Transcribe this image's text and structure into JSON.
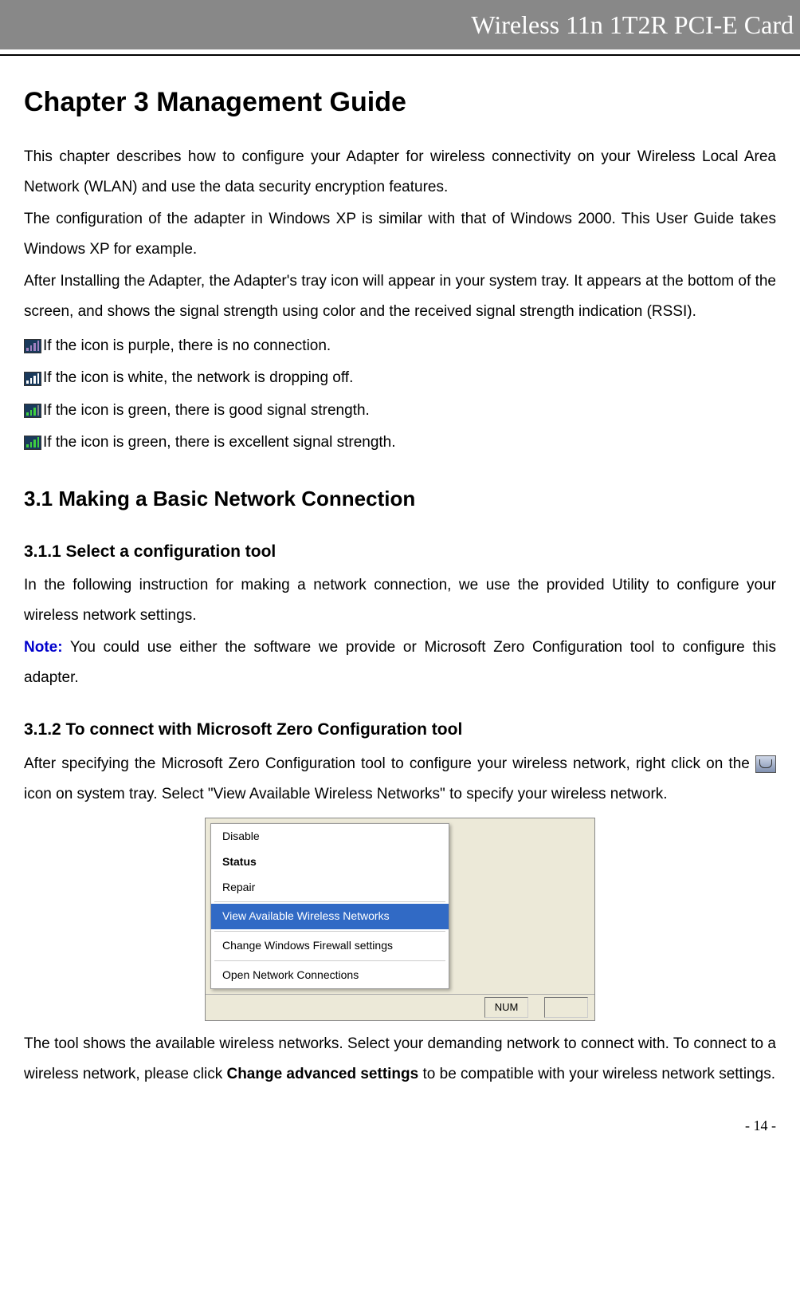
{
  "header": {
    "product": "Wireless 11n 1T2R PCI-E Card"
  },
  "chapter": {
    "title": "Chapter 3   Management Guide"
  },
  "paragraphs": {
    "intro1": "This chapter describes how to configure your Adapter for wireless connectivity on your Wireless Local Area Network (WLAN) and use the data security encryption features.",
    "intro2": "The configuration of the adapter in Windows XP is similar with that of Windows 2000. This User Guide takes Windows XP for example.",
    "intro3": "After Installing the Adapter, the Adapter's tray icon will appear in your system tray. It appears at the bottom of the screen, and shows the signal strength using color and the received signal strength indication (RSSI)."
  },
  "iconLines": {
    "purple": "If the icon is purple, there is no connection.",
    "white": "If the icon is white, the network is dropping off.",
    "greenGood": "If the icon is green, there is good signal strength.",
    "greenExcellent": "If the icon is green, there is excellent signal strength."
  },
  "section31": {
    "title": "3.1 Making a Basic Network Connection"
  },
  "section311": {
    "title": "3.1.1    Select a configuration tool",
    "text": "In the following instruction for making a network connection, we use the provided Utility to configure your wireless network settings.",
    "noteLabel": "Note:",
    "noteText": " You could use either the software we provide or Microsoft Zero Configuration tool to configure this adapter."
  },
  "section312": {
    "title": "3.1.2    To connect with Microsoft Zero Configuration tool",
    "textBefore": "After specifying the Microsoft Zero Configuration tool to configure your wireless network, right click on the ",
    "textAfter": " icon on system tray. Select \"View Available Wireless Networks\" to specify your wireless network."
  },
  "contextMenu": {
    "items": [
      "Disable",
      "Status",
      "Repair",
      "View Available Wireless Networks",
      "Change Windows Firewall settings",
      "Open Network Connections"
    ],
    "highlightedIndex": 3,
    "boldIndex": 1,
    "statusCells": [
      "NUM",
      ""
    ]
  },
  "afterScreenshot": {
    "textStart": "The tool shows the available wireless networks. Select your demanding network to connect with. To connect to a wireless network, please click ",
    "boldPart": "Change advanced settings",
    "textEnd": " to be compatible with your wireless network settings."
  },
  "footer": {
    "page": "- 14 -"
  }
}
